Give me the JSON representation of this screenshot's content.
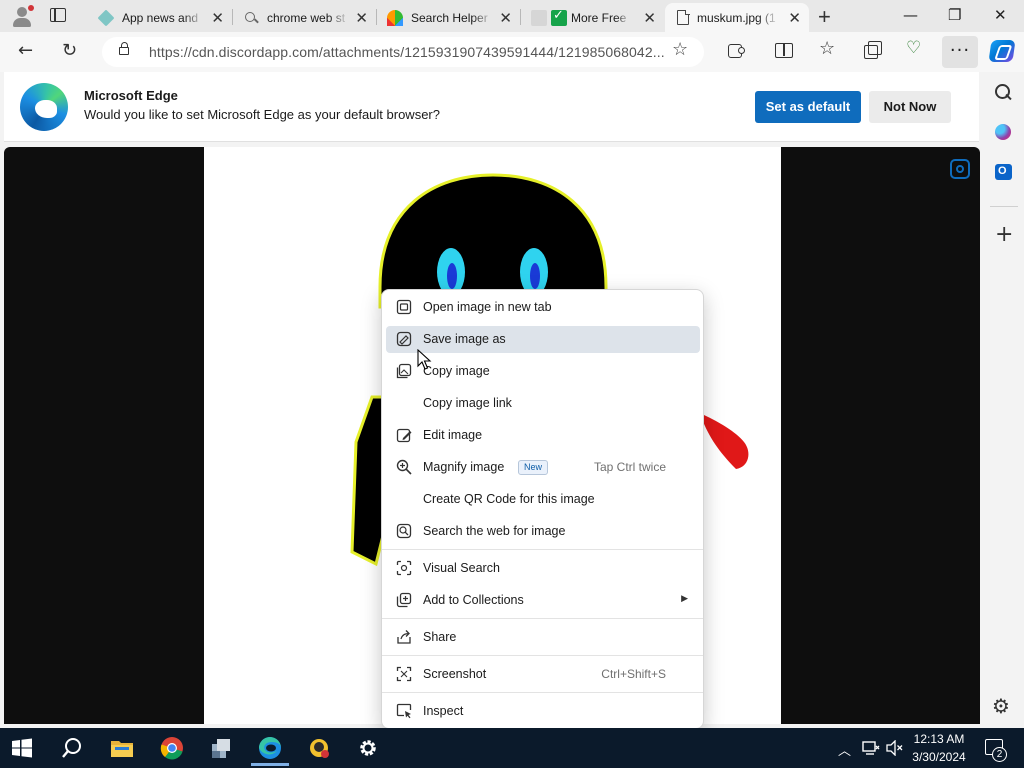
{
  "browser": {
    "tabs": [
      {
        "title": "App news and",
        "icon": "diamond-favicon"
      },
      {
        "title": "chrome web st",
        "icon": "search-favicon"
      },
      {
        "title": "Search Helper",
        "icon": "rainbow-favicon"
      },
      {
        "title": "More Free",
        "icon": "check-favicon"
      },
      {
        "title": "muskum.jpg (1",
        "icon": "document-favicon",
        "active": true
      }
    ],
    "url": "https://cdn.discordapp.com/attachments/1215931907439591444/121985068042..."
  },
  "infobar": {
    "title": "Microsoft Edge",
    "message": "Would you like to set Microsoft Edge as your default browser?",
    "primary_button": "Set as default",
    "secondary_button": "Not Now"
  },
  "context_menu": {
    "items": [
      {
        "label": "Open image in new tab",
        "icon": "open-new-tab-icon"
      },
      {
        "label": "Save image as",
        "icon": "save-image-icon",
        "highlighted": true
      },
      {
        "label": "Copy image",
        "icon": "copy-image-icon"
      },
      {
        "label": "Copy image link",
        "icon": ""
      },
      {
        "label": "Edit image",
        "icon": "edit-image-icon"
      },
      {
        "label": "Magnify image",
        "icon": "magnify-icon",
        "badge": "New",
        "shortcut": "Tap Ctrl twice"
      },
      {
        "label": "Create QR Code for this image",
        "icon": ""
      },
      {
        "label": "Search the web for image",
        "icon": "search-image-icon"
      },
      {
        "label": "Visual Search",
        "icon": "visual-search-icon"
      },
      {
        "label": "Add to Collections",
        "icon": "collections-icon",
        "submenu": true
      },
      {
        "label": "Share",
        "icon": "share-icon"
      },
      {
        "label": "Screenshot",
        "icon": "screenshot-icon",
        "shortcut": "Ctrl+Shift+S"
      },
      {
        "label": "Inspect",
        "icon": "inspect-icon"
      }
    ]
  },
  "taskbar": {
    "time": "12:13 AM",
    "date": "3/30/2024",
    "notification_count": "2"
  },
  "colors": {
    "accent": "#0f6cbd",
    "menu_highlight": "#dde3ea",
    "taskbar": "#0b1a2b"
  }
}
